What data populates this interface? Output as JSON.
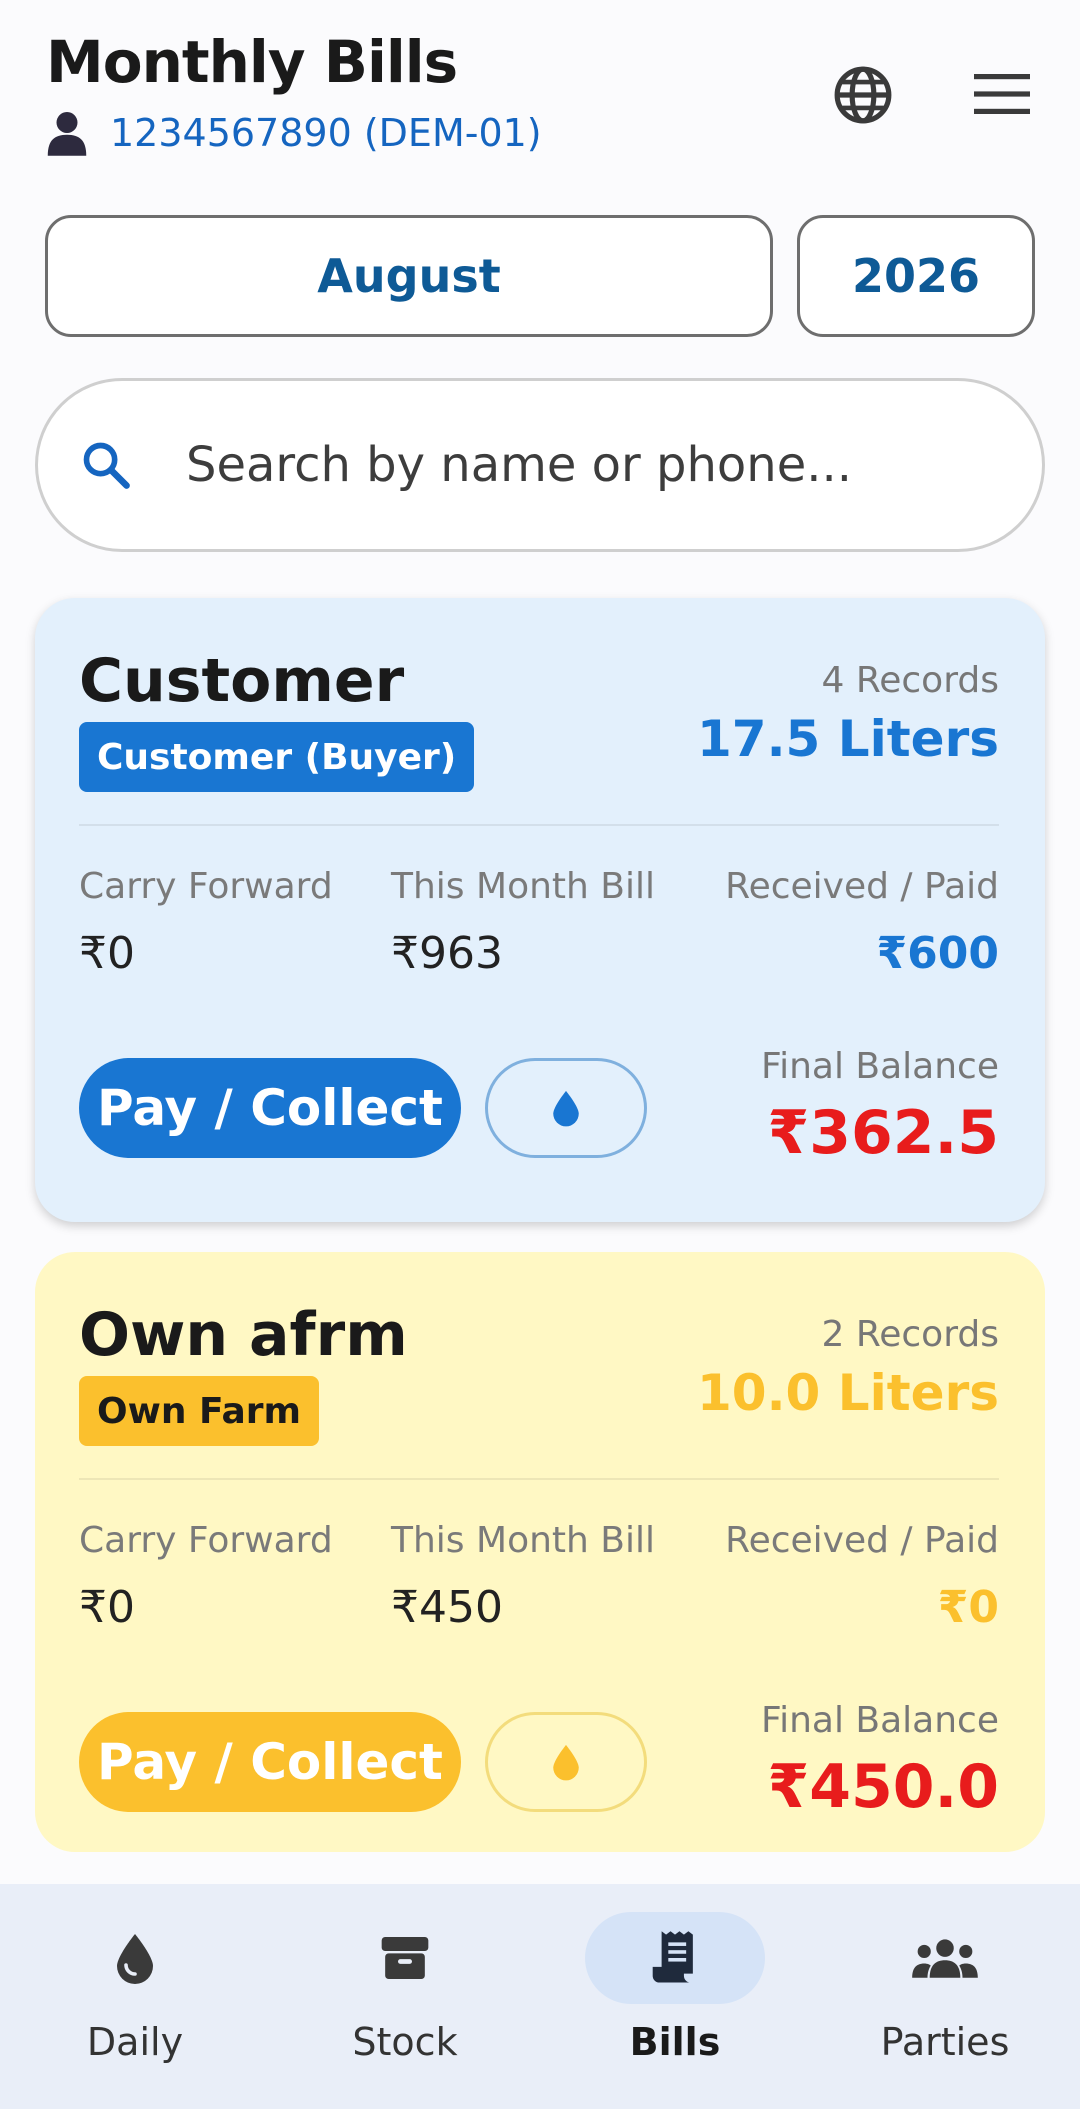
{
  "header": {
    "title": "Monthly Bills",
    "user": "1234567890 (DEM-01)"
  },
  "period": {
    "month": "August",
    "year": "2026"
  },
  "search": {
    "placeholder": "Search by name or phone..."
  },
  "colors": {
    "blue": "#1976d2",
    "yellow": "#fbc02d",
    "red": "#e81c1c"
  },
  "labels": {
    "carry_forward": "Carry Forward",
    "this_month_bill": "This Month Bill",
    "received_paid": "Received / Paid",
    "final_balance": "Final Balance",
    "pay_collect": "Pay / Collect"
  },
  "cards": [
    {
      "name": "Customer",
      "badge": "Customer (Buyer)",
      "records": "4 Records",
      "liters": "17.5 Liters",
      "carry_forward": "₹0",
      "this_month_bill": "₹963",
      "received_paid": "₹600",
      "final_balance": "₹362.5"
    },
    {
      "name": "Own afrm",
      "badge": "Own Farm",
      "records": "2 Records",
      "liters": "10.0 Liters",
      "carry_forward": "₹0",
      "this_month_bill": "₹450",
      "received_paid": "₹0",
      "final_balance": "₹450.0"
    }
  ],
  "nav": [
    {
      "label": "Daily",
      "icon": "water-drop-icon"
    },
    {
      "label": "Stock",
      "icon": "archive-box-icon"
    },
    {
      "label": "Bills",
      "icon": "receipt-icon",
      "active": true
    },
    {
      "label": "Parties",
      "icon": "group-icon"
    }
  ]
}
